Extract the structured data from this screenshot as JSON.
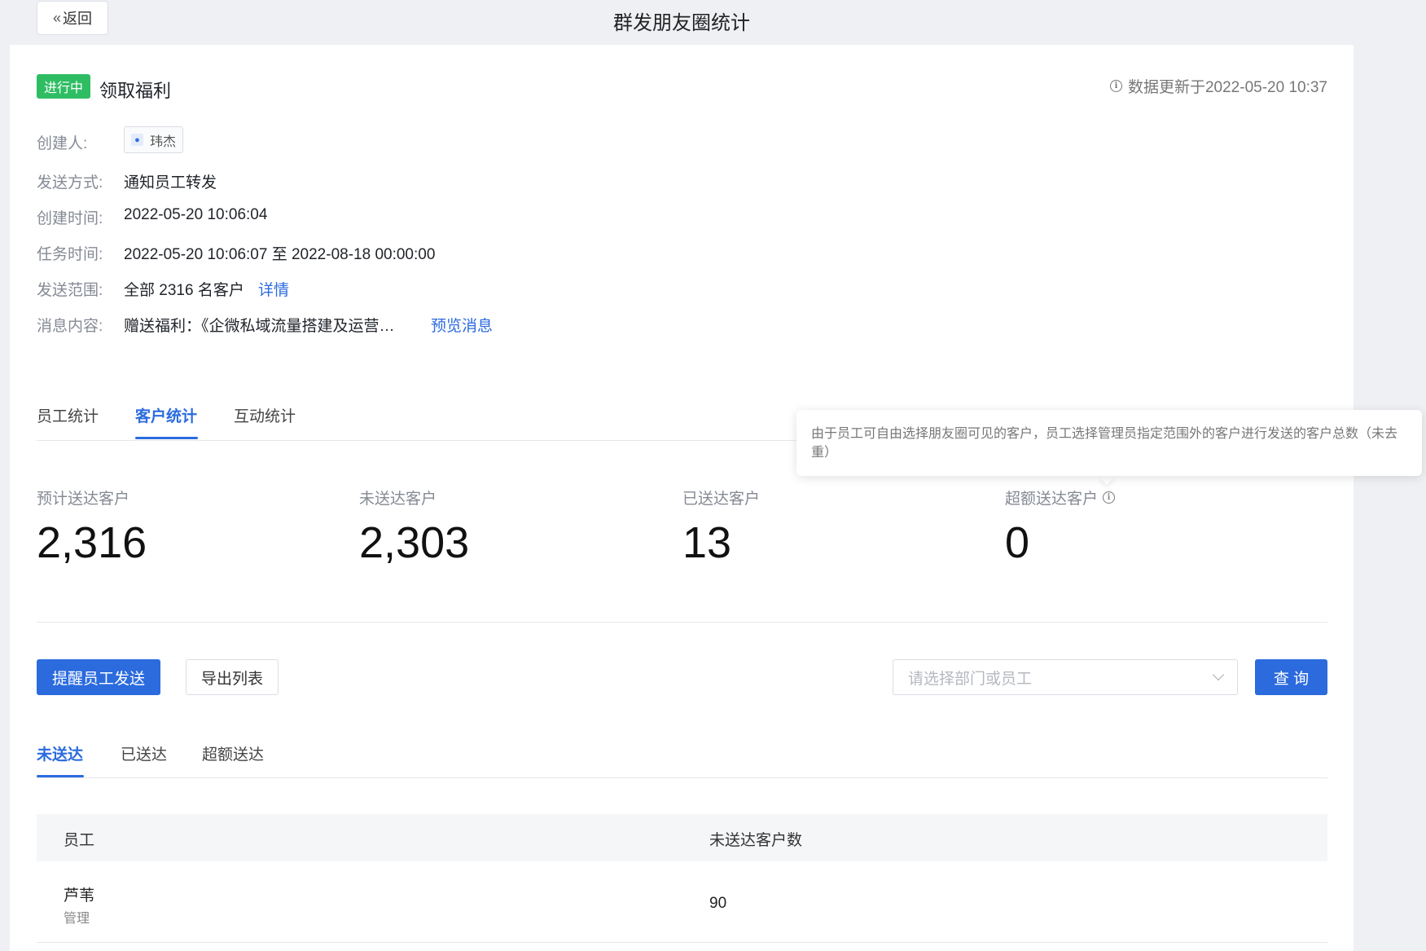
{
  "header": {
    "back_label": "返回",
    "title": "群发朋友圈统计"
  },
  "campaign": {
    "status": "进行中",
    "status_color": "#2fbd63",
    "name": "领取福利",
    "update_time": "数据更新于2022-05-20 10:37"
  },
  "meta": {
    "creator_label": "创建人:",
    "creator_name": "玮杰",
    "send_method_label": "发送方式:",
    "send_method": "通知员工转发",
    "created_label": "创建时间:",
    "created_time": "2022-05-20 10:06:04",
    "task_time_label": "任务时间:",
    "task_time": "2022-05-20 10:06:07 至 2022-08-18 00:00:00",
    "scope_label": "发送范围:",
    "scope": "全部 2316 名客户",
    "scope_link": "详情",
    "content_label": "消息内容:",
    "content": "赠送福利：《企微私域流量搭建及运营…",
    "preview_link": "预览消息"
  },
  "tabs": [
    {
      "label": "员工统计"
    },
    {
      "label": "客户统计"
    },
    {
      "label": "互动统计"
    }
  ],
  "active_tab": "客户统计",
  "stats": [
    {
      "label": "预计送达客户",
      "value": "2,316"
    },
    {
      "label": "未送达客户",
      "value": "2,303"
    },
    {
      "label": "已送达客户",
      "value": "13"
    },
    {
      "label": "超额送达客户",
      "value": "0"
    }
  ],
  "tooltip": "由于员工可自由选择朋友圈可见的客户，员工选择管理员指定范围外的客户进行发送的客户总数（未去重）",
  "actions": {
    "remind_label": "提醒员工发送",
    "export_label": "导出列表",
    "select_placeholder": "请选择部门或员工",
    "query_label": "查 询"
  },
  "sub_tabs": [
    {
      "label": "未送达"
    },
    {
      "label": "已送达"
    },
    {
      "label": "超额送达"
    }
  ],
  "active_sub_tab": "未送达",
  "table": {
    "columns": [
      "员工",
      "未送达客户数"
    ],
    "rows": [
      {
        "name": "芦苇",
        "dept": "管理",
        "count": "90"
      }
    ]
  },
  "colors": {
    "accent": "#2b6bde",
    "success": "#2fbd63",
    "background": "#eef0f4"
  }
}
